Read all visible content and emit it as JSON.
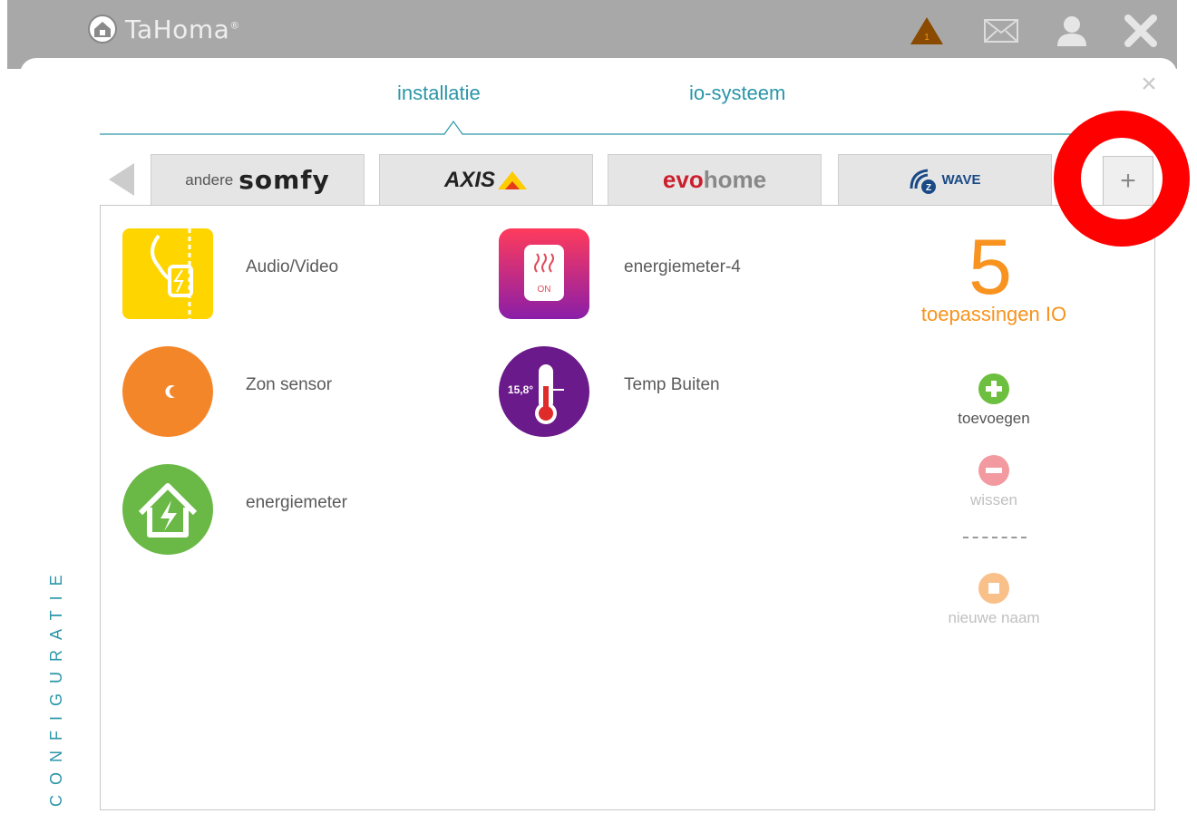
{
  "app": {
    "title": "TaHoma",
    "trademark": "®",
    "alert_badge": "1"
  },
  "tabs": {
    "installatie": "installatie",
    "io_systeem": "io-systeem"
  },
  "brands": {
    "somfy_prefix": "andere",
    "somfy": "somfy",
    "axis": "AXIS",
    "evohome_evo": "evo",
    "evohome_home": "home",
    "zwave": "WAVE",
    "add": "+"
  },
  "side_label": "CONFIGURATIE",
  "devices": [
    {
      "label": "Audio/Video",
      "icon": "plug-icon"
    },
    {
      "label": "energiemeter-4",
      "icon": "heater-on-icon"
    },
    {
      "label": "Zon sensor",
      "icon": "moon-sensor-icon"
    },
    {
      "label": "Temp Buiten",
      "icon": "thermometer-icon",
      "reading": "15,8°"
    },
    {
      "label": "energiemeter",
      "icon": "house-lightning-icon"
    }
  ],
  "heater_badge": "ON",
  "summary": {
    "count": "5",
    "label": "toepassingen IO"
  },
  "actions": {
    "add": "toevoegen",
    "delete": "wissen",
    "rename": "nieuwe naam"
  },
  "colors": {
    "accent_teal": "#2a96a8",
    "orange": "#f7931e",
    "green": "#6dbf3f",
    "pink": "#f29aa0",
    "peach": "#f9c08a",
    "highlight_red": "#ff0000"
  }
}
